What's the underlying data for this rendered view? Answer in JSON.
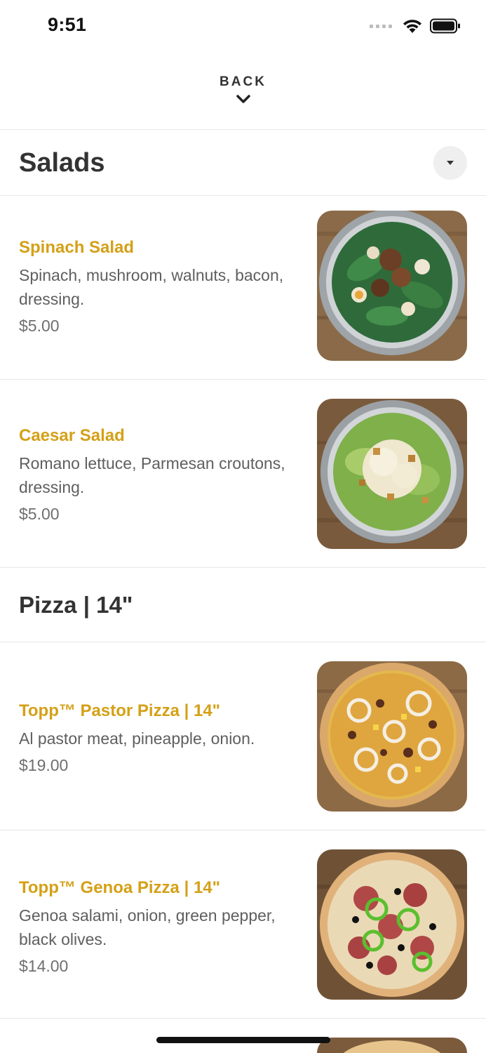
{
  "status_bar": {
    "time": "9:51"
  },
  "back": {
    "label": "BACK"
  },
  "categories": [
    {
      "title": "Salads"
    },
    {
      "title": "Pizza | 14\""
    }
  ],
  "items": [
    {
      "name": "Spinach Salad",
      "description": "Spinach, mushroom, walnuts, bacon, dressing.",
      "price": "$5.00",
      "image": "spinach-salad-bowl"
    },
    {
      "name": "Caesar Salad",
      "description": "Romano lettuce, Parmesan croutons, dressing.",
      "price": "$5.00",
      "image": "caesar-salad-bowl"
    },
    {
      "name": "Topp™ Pastor Pizza | 14\"",
      "description": "Al pastor meat, pineapple, onion.",
      "price": "$19.00",
      "image": "pastor-pizza"
    },
    {
      "name": "Topp™ Genoa Pizza | 14\"",
      "description": "Genoa salami, onion, green pepper, black olives.",
      "price": "$14.00",
      "image": "genoa-pizza"
    }
  ],
  "colors": {
    "accent": "#d4a017",
    "text": "#333333",
    "muted": "#5f5f5f",
    "divider": "#e6e6e6"
  }
}
